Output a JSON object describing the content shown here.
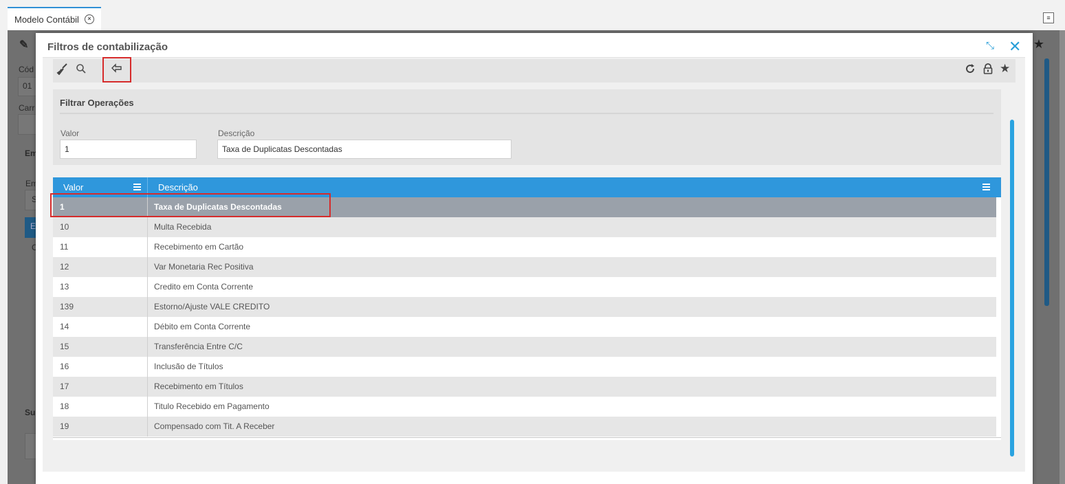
{
  "app_tab": {
    "title": "Modelo Contábil",
    "close_icon": "close-circle-icon"
  },
  "background": {
    "fragments": [
      "Cód",
      "01",
      "Carr",
      "Em",
      "Em",
      "S",
      "E",
      "C",
      "Su"
    ]
  },
  "modal": {
    "title": "Filtros de contabilização",
    "toolbar": {
      "left_icons": [
        "broom-icon",
        "search-icon",
        "back-arrow-icon"
      ],
      "right_icons": [
        "refresh-icon",
        "lock-icon",
        "star-icon"
      ]
    },
    "filter": {
      "title": "Filtrar Operações",
      "valor_label": "Valor",
      "valor_value": "1",
      "descricao_label": "Descrição",
      "descricao_value": "Taxa de Duplicatas Descontadas"
    },
    "grid": {
      "columns": [
        "Valor",
        "Descrição"
      ],
      "rows": [
        {
          "valor": "1",
          "descricao": "Taxa de Duplicatas Descontadas",
          "selected": true
        },
        {
          "valor": "10",
          "descricao": "Multa Recebida"
        },
        {
          "valor": "11",
          "descricao": "Recebimento em Cartão"
        },
        {
          "valor": "12",
          "descricao": "Var Monetaria Rec Positiva"
        },
        {
          "valor": "13",
          "descricao": "Credito em Conta Corrente"
        },
        {
          "valor": "139",
          "descricao": "Estorno/Ajuste VALE CREDITO"
        },
        {
          "valor": "14",
          "descricao": "Débito em Conta Corrente"
        },
        {
          "valor": "15",
          "descricao": "Transferência Entre C/C"
        },
        {
          "valor": "16",
          "descricao": "Inclusão de Títulos"
        },
        {
          "valor": "17",
          "descricao": "Recebimento em Títulos"
        },
        {
          "valor": "18",
          "descricao": "Titulo Recebido em Pagamento"
        },
        {
          "valor": "19",
          "descricao": "Compensado com Tit. A Receber"
        }
      ]
    }
  },
  "colors": {
    "accent": "#2f97dc",
    "highlight": "#d62b2b",
    "selected_row": "#9aa1aa"
  }
}
